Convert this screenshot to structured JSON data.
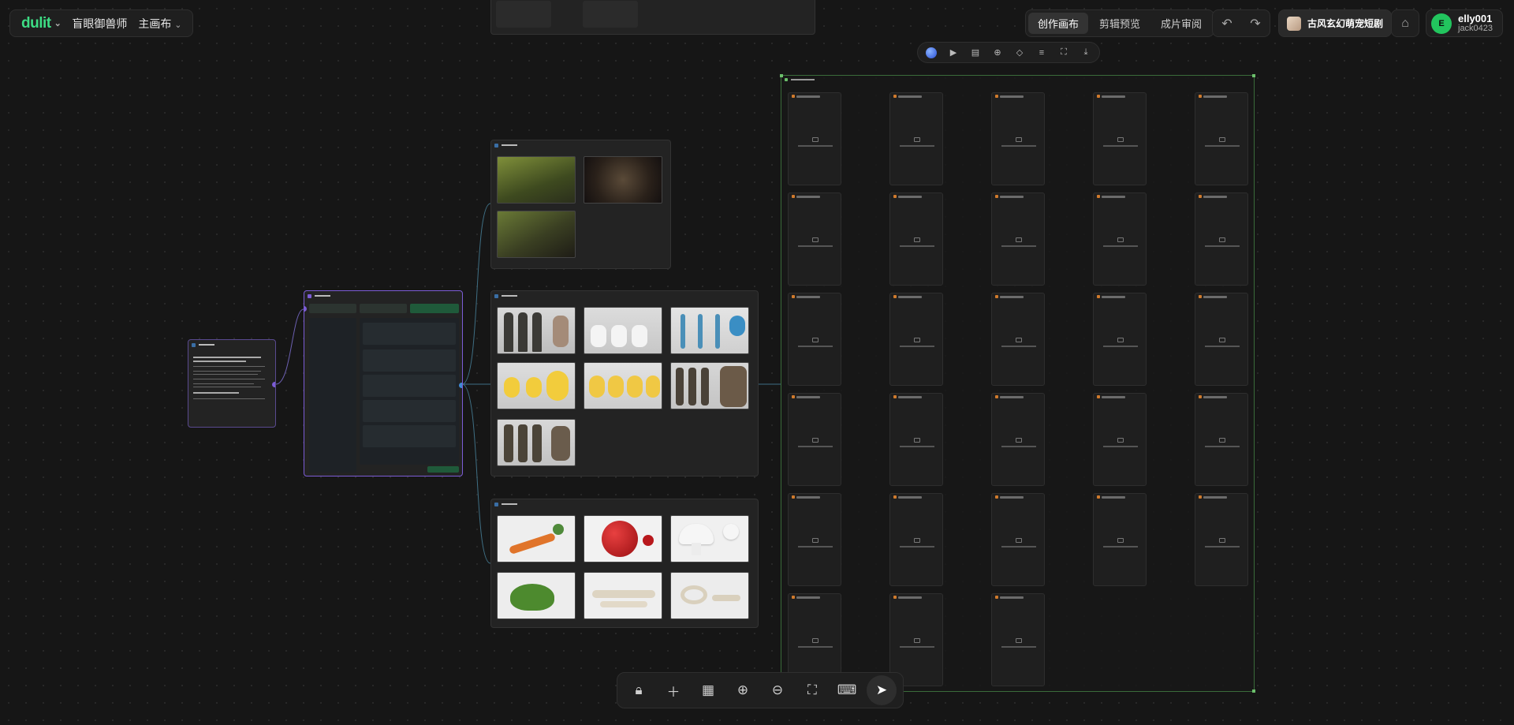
{
  "brand": {
    "logo": "dulit"
  },
  "project": {
    "name": "盲眼御兽师",
    "canvas": "主画布"
  },
  "mode_tabs": [
    {
      "label": "创作画布",
      "active": true
    },
    {
      "label": "剪辑预览",
      "active": false
    },
    {
      "label": "成片审阅",
      "active": false
    }
  ],
  "project_button": {
    "label": "古风玄幻萌宠短剧"
  },
  "user": {
    "initial": "E",
    "name": "elly001",
    "id": "jack0423"
  },
  "icons": {
    "undo": "undo-icon",
    "redo": "redo-icon",
    "robot": "robot-icon",
    "lock": "lock-icon",
    "add": "plus-icon",
    "layout": "layout-icon",
    "zoom_in": "zoom-in-icon",
    "zoom_out": "zoom-out-icon",
    "fit": "fit-screen-icon",
    "keyboard": "keyboard-icon",
    "select": "cursor-icon"
  },
  "colors": {
    "accent": "#3ddc84",
    "node_border_active": "#7c5cd6",
    "frame_border": "#3a6b3a"
  }
}
